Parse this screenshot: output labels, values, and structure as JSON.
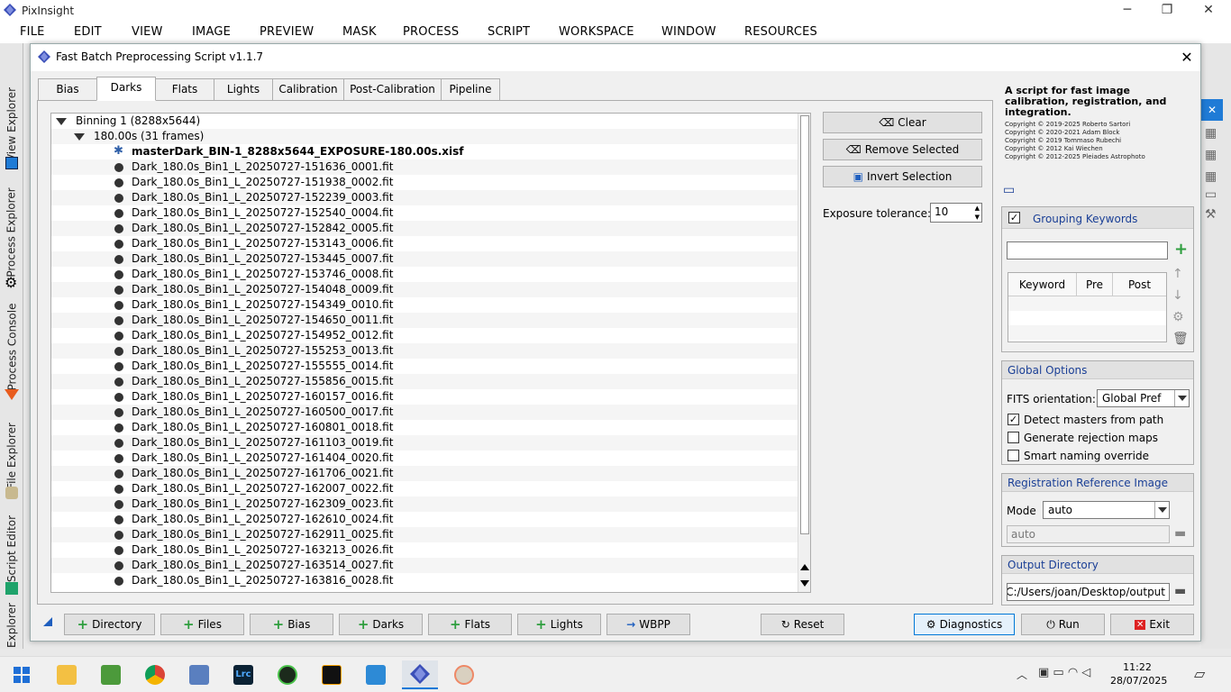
{
  "app": {
    "title": "PixInsight",
    "min": "─",
    "max": "❐",
    "close": "✕"
  },
  "menu": [
    "FILE",
    "EDIT",
    "VIEW",
    "IMAGE",
    "PREVIEW",
    "MASK",
    "PROCESS",
    "SCRIPT",
    "WORKSPACE",
    "WINDOW",
    "RESOURCES"
  ],
  "dock": {
    "tabs": [
      "View Explorer",
      "Process Explorer",
      "Process Console",
      "File Explorer",
      "Script Editor",
      "Explorer"
    ]
  },
  "dialog": {
    "title": "Fast Batch Preprocessing Script v1.1.7",
    "close": "✕"
  },
  "tabs": [
    "Bias",
    "Darks",
    "Flats",
    "Lights",
    "Calibration",
    "Post-Calibration",
    "Pipeline"
  ],
  "active_tab": "Darks",
  "tree": {
    "binning": "Binning 1 (8288x5644)",
    "exposure": "180.00s (31 frames)",
    "master": "masterDark_BIN-1_8288x5644_EXPOSURE-180.00s.xisf",
    "files": [
      "Dark_180.0s_Bin1_L_20250727-151636_0001.fit",
      "Dark_180.0s_Bin1_L_20250727-151938_0002.fit",
      "Dark_180.0s_Bin1_L_20250727-152239_0003.fit",
      "Dark_180.0s_Bin1_L_20250727-152540_0004.fit",
      "Dark_180.0s_Bin1_L_20250727-152842_0005.fit",
      "Dark_180.0s_Bin1_L_20250727-153143_0006.fit",
      "Dark_180.0s_Bin1_L_20250727-153445_0007.fit",
      "Dark_180.0s_Bin1_L_20250727-153746_0008.fit",
      "Dark_180.0s_Bin1_L_20250727-154048_0009.fit",
      "Dark_180.0s_Bin1_L_20250727-154349_0010.fit",
      "Dark_180.0s_Bin1_L_20250727-154650_0011.fit",
      "Dark_180.0s_Bin1_L_20250727-154952_0012.fit",
      "Dark_180.0s_Bin1_L_20250727-155253_0013.fit",
      "Dark_180.0s_Bin1_L_20250727-155555_0014.fit",
      "Dark_180.0s_Bin1_L_20250727-155856_0015.fit",
      "Dark_180.0s_Bin1_L_20250727-160157_0016.fit",
      "Dark_180.0s_Bin1_L_20250727-160500_0017.fit",
      "Dark_180.0s_Bin1_L_20250727-160801_0018.fit",
      "Dark_180.0s_Bin1_L_20250727-161103_0019.fit",
      "Dark_180.0s_Bin1_L_20250727-161404_0020.fit",
      "Dark_180.0s_Bin1_L_20250727-161706_0021.fit",
      "Dark_180.0s_Bin1_L_20250727-162007_0022.fit",
      "Dark_180.0s_Bin1_L_20250727-162309_0023.fit",
      "Dark_180.0s_Bin1_L_20250727-162610_0024.fit",
      "Dark_180.0s_Bin1_L_20250727-162911_0025.fit",
      "Dark_180.0s_Bin1_L_20250727-163213_0026.fit",
      "Dark_180.0s_Bin1_L_20250727-163514_0027.fit",
      "Dark_180.0s_Bin1_L_20250727-163816_0028.fit"
    ]
  },
  "side_buttons": {
    "clear": "Clear",
    "remove": "Remove Selected",
    "invert": "Invert Selection"
  },
  "exposure_tolerance": {
    "label": "Exposure tolerance:",
    "value": "10"
  },
  "about": {
    "title": "A script for fast image calibration, registration, and integration.",
    "copyrights": [
      "Copyright © 2019-2025 Roberto Sartori",
      "Copyright © 2020-2021 Adam Block",
      "Copyright © 2019 Tommaso Rubechi",
      "Copyright © 2012 Kai Wiechen",
      "Copyright © 2012-2025 Pleiades Astrophoto"
    ]
  },
  "grouping": {
    "title": "Grouping Keywords",
    "checked": true,
    "input": "",
    "columns": [
      "Keyword",
      "Pre",
      "Post"
    ]
  },
  "global_options": {
    "title": "Global Options",
    "fits_label": "FITS orientation:",
    "fits_value": "Global Pref",
    "options": [
      {
        "label": "Detect masters from path",
        "checked": true
      },
      {
        "label": "Generate rejection maps",
        "checked": false
      },
      {
        "label": "Smart naming override",
        "checked": false
      }
    ]
  },
  "registration": {
    "title": "Registration Reference Image",
    "mode_label": "Mode",
    "mode_value": "auto",
    "field": "auto"
  },
  "output": {
    "title": "Output Directory",
    "path": "C:/Users/joan/Desktop/output"
  },
  "bottom": {
    "directory": "Directory",
    "files": "Files",
    "bias": "Bias",
    "darks": "Darks",
    "flats": "Flats",
    "lights": "Lights",
    "wbpp": "WBPP",
    "reset": "Reset",
    "diagnostics": "Diagnostics",
    "run": "Run",
    "exit": "Exit"
  },
  "taskbar": {
    "time": "11:22",
    "date": "28/07/2025"
  }
}
